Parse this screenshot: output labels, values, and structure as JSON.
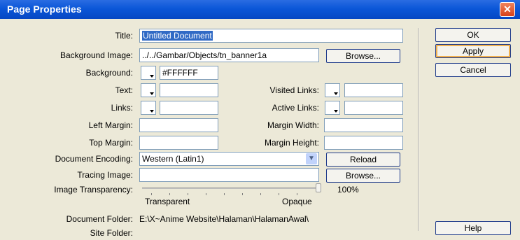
{
  "window": {
    "title": "Page Properties",
    "close_glyph": "✕"
  },
  "buttons": {
    "ok": "OK",
    "apply": "Apply",
    "cancel": "Cancel",
    "help": "Help",
    "browse": "Browse...",
    "reload": "Reload"
  },
  "fields": {
    "title": {
      "label": "Title:",
      "value": "Untitled Document"
    },
    "background_image": {
      "label": "Background Image:",
      "value": "../../Gambar/Objects/tn_banner1a"
    },
    "background": {
      "label": "Background:",
      "value": "#FFFFFF"
    },
    "text": {
      "label": "Text:",
      "value": ""
    },
    "visited_links": {
      "label": "Visited Links:",
      "value": ""
    },
    "links": {
      "label": "Links:",
      "value": ""
    },
    "active_links": {
      "label": "Active Links:",
      "value": ""
    },
    "left_margin": {
      "label": "Left Margin:",
      "value": ""
    },
    "margin_width": {
      "label": "Margin Width:",
      "value": ""
    },
    "top_margin": {
      "label": "Top Margin:",
      "value": ""
    },
    "margin_height": {
      "label": "Margin Height:",
      "value": ""
    },
    "document_encoding": {
      "label": "Document Encoding:",
      "value": "Western (Latin1)"
    },
    "tracing_image": {
      "label": "Tracing Image:",
      "value": ""
    },
    "image_transparency": {
      "label": "Image Transparency:",
      "percent_label": "100%",
      "min_label": "Transparent",
      "max_label": "Opaque",
      "level": 1.0
    }
  },
  "info": {
    "document_folder": {
      "label": "Document Folder:",
      "value": "E:\\X~Anime Website\\Halaman\\HalamanAwal\\"
    },
    "site_folder": {
      "label": "Site Folder:",
      "value": ""
    }
  },
  "colors": {
    "titlebar": "#0b57d8",
    "dialog_bg": "#ece9d8",
    "selection": "#316ac5",
    "close": "#d6401a"
  }
}
